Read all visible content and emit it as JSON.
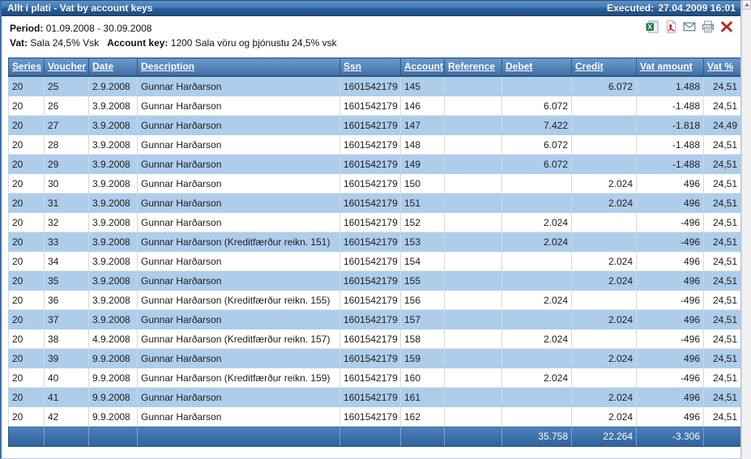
{
  "window": {
    "title": "Allt í plati - Vat by account keys",
    "executed_label": "Executed:",
    "executed_value": "27.04.2009 16:01"
  },
  "info": {
    "period_label": "Period:",
    "period_value": "01.09.2008 - 30.09.2008",
    "vat_label": "Vat:",
    "vat_value": "Sala 24,5% Vsk",
    "account_key_label": "Account key:",
    "account_key_value": "1200 Sala vöru og þjónustu 24,5% vsk"
  },
  "toolbar": {
    "icons": [
      {
        "name": "excel-export-icon",
        "title": "Export to Excel"
      },
      {
        "name": "pdf-export-icon",
        "title": "Export to PDF"
      },
      {
        "name": "email-icon",
        "title": "Send by e-mail"
      },
      {
        "name": "print-icon",
        "title": "Print"
      },
      {
        "name": "close-icon",
        "title": "Close"
      }
    ]
  },
  "table": {
    "columns": [
      "Series",
      "Voucher",
      "Date",
      "Description",
      "Ssn",
      "Account",
      "Reference",
      "Debet",
      "Credit",
      "Vat amount",
      "Vat %"
    ],
    "rows": [
      [
        "20",
        "25",
        "2.9.2008",
        "Gunnar Harðarson",
        "1601542179",
        "145",
        "",
        "",
        "6.072",
        "1.488",
        "24,51"
      ],
      [
        "20",
        "26",
        "3.9.2008",
        "Gunnar Harðarson",
        "1601542179",
        "146",
        "",
        "6.072",
        "",
        "-1.488",
        "24,51"
      ],
      [
        "20",
        "27",
        "3.9.2008",
        "Gunnar Harðarson",
        "1601542179",
        "147",
        "",
        "7.422",
        "",
        "-1.818",
        "24,49"
      ],
      [
        "20",
        "28",
        "3.9.2008",
        "Gunnar Harðarson",
        "1601542179",
        "148",
        "",
        "6.072",
        "",
        "-1.488",
        "24,51"
      ],
      [
        "20",
        "29",
        "3.9.2008",
        "Gunnar Harðarson",
        "1601542179",
        "149",
        "",
        "6.072",
        "",
        "-1.488",
        "24,51"
      ],
      [
        "20",
        "30",
        "3.9.2008",
        "Gunnar Harðarson",
        "1601542179",
        "150",
        "",
        "",
        "2.024",
        "496",
        "24,51"
      ],
      [
        "20",
        "31",
        "3.9.2008",
        "Gunnar Harðarson",
        "1601542179",
        "151",
        "",
        "",
        "2.024",
        "496",
        "24,51"
      ],
      [
        "20",
        "32",
        "3.9.2008",
        "Gunnar Harðarson",
        "1601542179",
        "152",
        "",
        "2.024",
        "",
        "-496",
        "24,51"
      ],
      [
        "20",
        "33",
        "3.9.2008",
        "Gunnar Harðarson (Kreditfærður reikn. 151)",
        "1601542179",
        "153",
        "",
        "2.024",
        "",
        "-496",
        "24,51"
      ],
      [
        "20",
        "34",
        "3.9.2008",
        "Gunnar Harðarson",
        "1601542179",
        "154",
        "",
        "",
        "2.024",
        "496",
        "24,51"
      ],
      [
        "20",
        "35",
        "3.9.2008",
        "Gunnar Harðarson",
        "1601542179",
        "155",
        "",
        "",
        "2.024",
        "496",
        "24,51"
      ],
      [
        "20",
        "36",
        "3.9.2008",
        "Gunnar Harðarson (Kreditfærður reikn. 155)",
        "1601542179",
        "156",
        "",
        "2.024",
        "",
        "-496",
        "24,51"
      ],
      [
        "20",
        "37",
        "3.9.2008",
        "Gunnar Harðarson",
        "1601542179",
        "157",
        "",
        "",
        "2.024",
        "496",
        "24,51"
      ],
      [
        "20",
        "38",
        "4.9.2008",
        "Gunnar Harðarson (Kreditfærður reikn. 157)",
        "1601542179",
        "158",
        "",
        "2.024",
        "",
        "-496",
        "24,51"
      ],
      [
        "20",
        "39",
        "9.9.2008",
        "Gunnar Harðarson",
        "1601542179",
        "159",
        "",
        "",
        "2.024",
        "496",
        "24,51"
      ],
      [
        "20",
        "40",
        "9.9.2008",
        "Gunnar Harðarson (Kreditfærður reikn. 159)",
        "1601542179",
        "160",
        "",
        "2.024",
        "",
        "-496",
        "24,51"
      ],
      [
        "20",
        "41",
        "9.9.2008",
        "Gunnar Harðarson",
        "1601542179",
        "161",
        "",
        "",
        "2.024",
        "496",
        "24,51"
      ],
      [
        "20",
        "42",
        "9.9.2008",
        "Gunnar Harðarson",
        "1601542179",
        "162",
        "",
        "",
        "2.024",
        "496",
        "24,51"
      ]
    ],
    "totals": [
      "",
      "",
      "",
      "",
      "",
      "",
      "",
      "35.758",
      "22.264",
      "-3.306",
      ""
    ],
    "numeric_columns": [
      7,
      8,
      9,
      10
    ]
  },
  "colors": {
    "titlebar_blue": "#2c5e96",
    "header_blue": "#5a89bf",
    "row_alt_blue": "#aecdeb",
    "total_blue": "#3e72ab",
    "close_red": "#cc2222"
  }
}
